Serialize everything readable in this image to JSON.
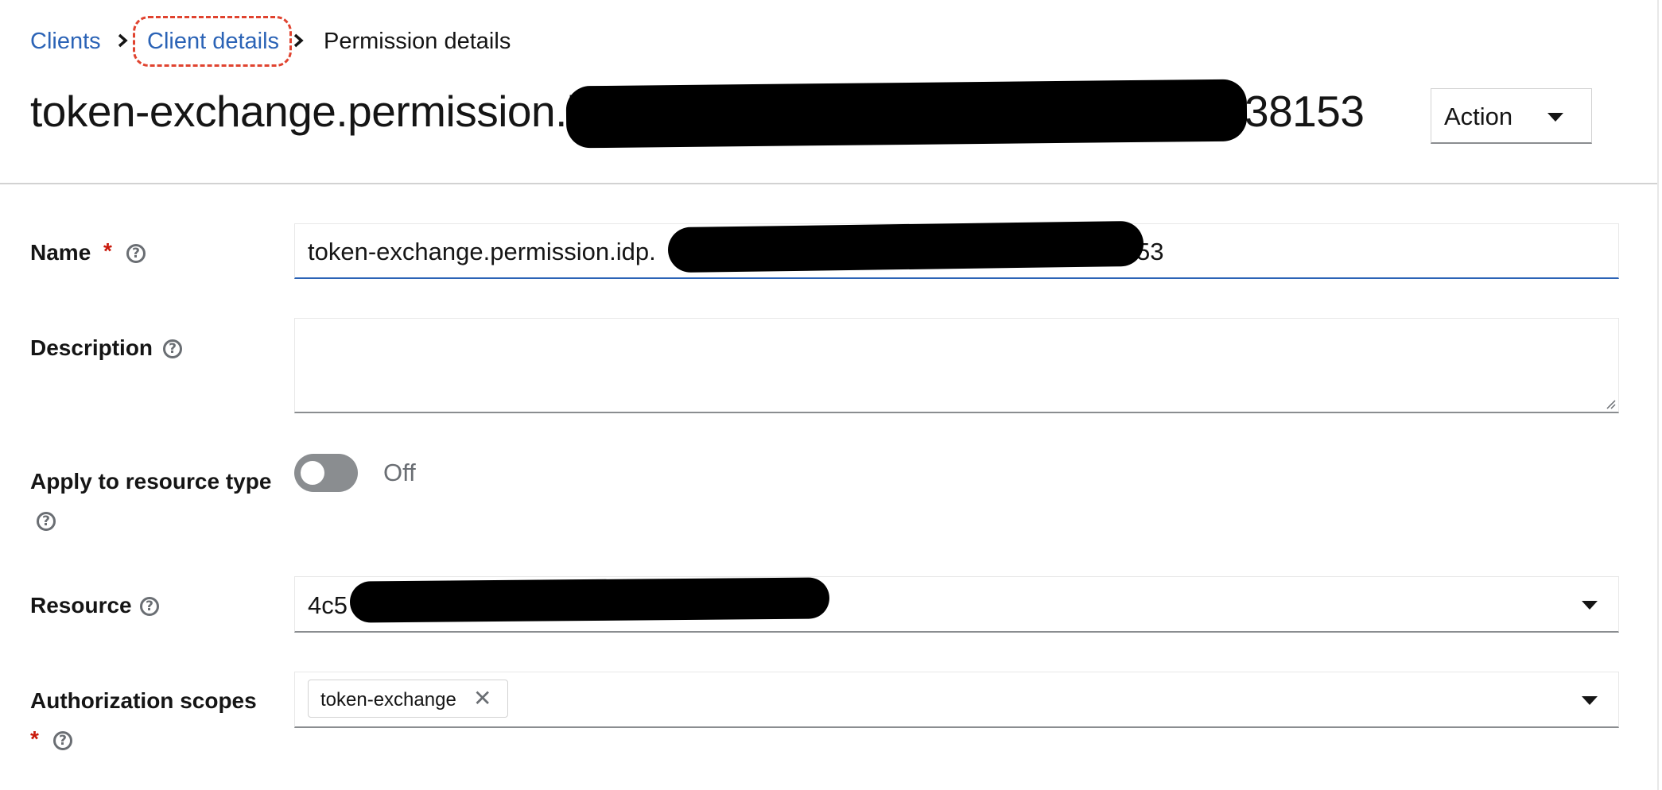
{
  "breadcrumb": {
    "items": [
      {
        "label": "Clients"
      },
      {
        "label": "Client details"
      },
      {
        "label": "Permission details"
      }
    ]
  },
  "page": {
    "title_prefix": "token-exchange.permission.idp",
    "title_suffix": "38153"
  },
  "action_menu": {
    "label": "Action"
  },
  "form": {
    "name": {
      "label": "Name",
      "required_mark": "*",
      "value_prefix": "token-exchange.permission.idp.",
      "value_suffix": "53"
    },
    "description": {
      "label": "Description",
      "value": ""
    },
    "apply_resource_type": {
      "label": "Apply to resource type",
      "state_text": "Off",
      "checked": false
    },
    "resource": {
      "label": "Resource",
      "value_prefix": "4c5"
    },
    "authorization_scopes": {
      "label": "Authorization scopes",
      "required_mark": "*",
      "chips": [
        {
          "label": "token-exchange"
        }
      ]
    }
  },
  "icons": {
    "help": "question-circle-icon",
    "dropdown": "caret-down-icon",
    "breadcrumb_separator": "angle-right-icon",
    "chip_remove": "times-icon"
  },
  "colors": {
    "link": "#2b63b6",
    "required": "#c9190b",
    "focus_border": "#2b63b6",
    "annotation_highlight": "#e0432f"
  }
}
